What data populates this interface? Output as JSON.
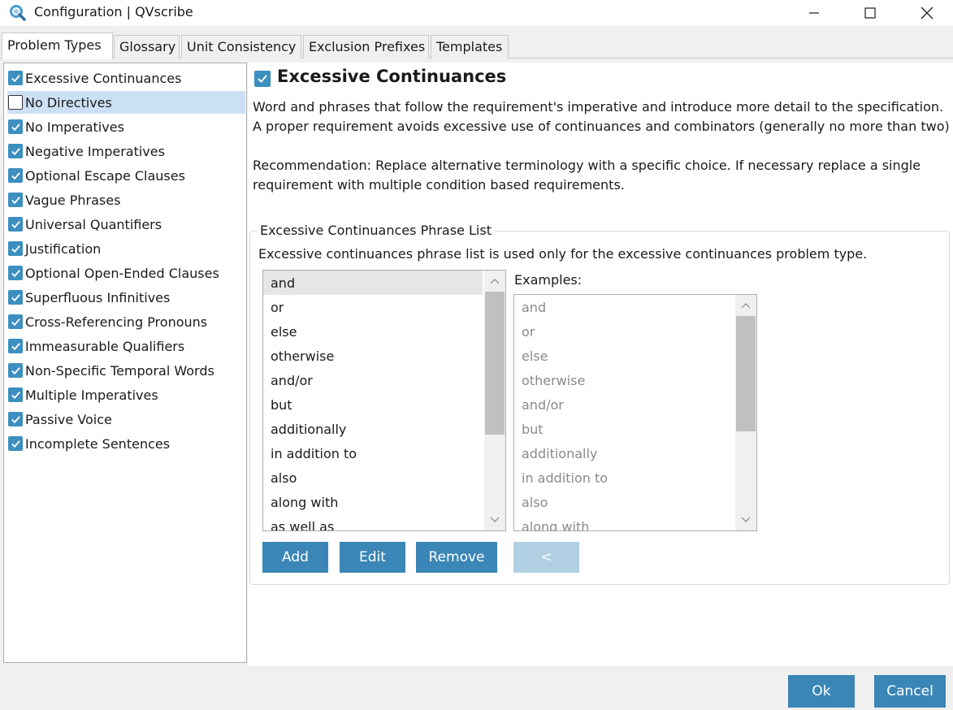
{
  "window": {
    "title": "Configuration | QVscribe",
    "minimize_icon": "minimize-icon",
    "maximize_icon": "maximize-icon",
    "close_icon": "close-icon"
  },
  "tabs": [
    {
      "label": "Problem Types",
      "active": true
    },
    {
      "label": "Glossary",
      "active": false
    },
    {
      "label": "Unit Consistency",
      "active": false
    },
    {
      "label": "Exclusion Prefixes",
      "active": false
    },
    {
      "label": "Templates",
      "active": false
    }
  ],
  "problem_types": [
    {
      "label": "Excessive Continuances",
      "checked": true
    },
    {
      "label": "No Directives",
      "checked": false,
      "selected": true
    },
    {
      "label": "No Imperatives",
      "checked": true
    },
    {
      "label": "Negative Imperatives",
      "checked": true
    },
    {
      "label": "Optional Escape Clauses",
      "checked": true
    },
    {
      "label": "Vague Phrases",
      "checked": true
    },
    {
      "label": "Universal Quantifiers",
      "checked": true
    },
    {
      "label": "Justification",
      "checked": true
    },
    {
      "label": "Optional Open-Ended Clauses",
      "checked": true
    },
    {
      "label": "Superfluous Infinitives",
      "checked": true
    },
    {
      "label": "Cross-Referencing Pronouns",
      "checked": true
    },
    {
      "label": "Immeasurable Qualifiers",
      "checked": true
    },
    {
      "label": "Non-Specific Temporal Words",
      "checked": true
    },
    {
      "label": "Multiple Imperatives",
      "checked": true
    },
    {
      "label": "Passive Voice",
      "checked": true
    },
    {
      "label": "Incomplete Sentences",
      "checked": true
    }
  ],
  "detail": {
    "title": "Excessive Continuances",
    "enabled": true,
    "description_line1": "Word and phrases that follow the requirement's imperative and introduce more detail to the specification.",
    "description_line2": "A proper requirement avoids excessive use of continuances and combinators (generally no more than two)",
    "recommendation_line1": "Recommendation: Replace alternative terminology with a specific choice. If necessary replace a single",
    "recommendation_line2": "requirement with multiple condition based requirements."
  },
  "phrase_group": {
    "legend": "Excessive Continuances Phrase List",
    "description": "Excessive continuances phrase list is used only for the excessive continuances problem type.",
    "phrases": [
      "and",
      "or",
      "else",
      "otherwise",
      "and/or",
      "but",
      "additionally",
      "in addition to",
      "also",
      "along with",
      "as well as"
    ],
    "selected_phrase": "and",
    "examples_label": "Examples:",
    "examples": [
      "and",
      "or",
      "else",
      "otherwise",
      "and/or",
      "but",
      "additionally",
      "in addition to",
      "also",
      "along with"
    ],
    "buttons": {
      "add": "Add",
      "edit": "Edit",
      "remove": "Remove",
      "move_left": "<"
    }
  },
  "footer": {
    "ok": "Ok",
    "cancel": "Cancel"
  },
  "colors": {
    "accent": "#3a86b6",
    "checkbox": "#3c8fbf",
    "selection": "#cce0f5"
  }
}
